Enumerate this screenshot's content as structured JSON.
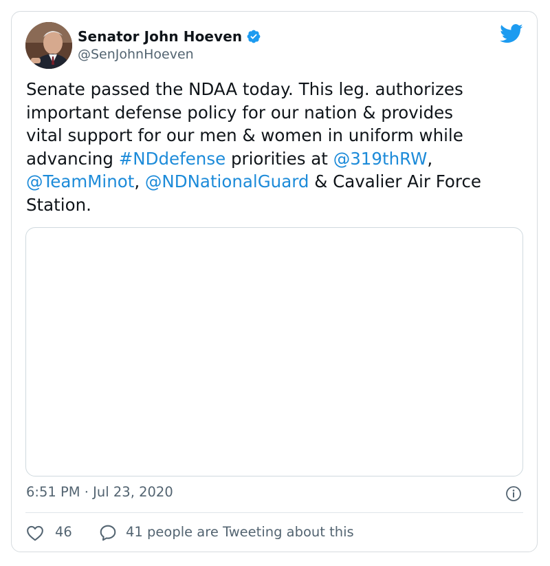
{
  "author": {
    "display_name": "Senator John Hoeven",
    "handle": "@SenJohnHoeven",
    "verified": true,
    "avatar": "portrait-photo"
  },
  "tweet": {
    "text_1": "Senate passed the NDAA today. This leg. authorizes\nimportant defense policy for our nation & provides\nvital support for our men & women in uniform while\nadvancing ",
    "hashtag": "#NDdefense",
    "text_2": " priorities at ",
    "mention_1": "@319thRW",
    "text_3": ",\n",
    "mention_2": "@TeamMinot",
    "text_4": ", ",
    "mention_3": "@NDNationalGuard",
    "text_5": " & Cavalier Air Force\nStation."
  },
  "timestamp": "6:51 PM · Jul 23, 2020",
  "engagement": {
    "like_count": "46",
    "discussion_text": "41 people are Tweeting about this"
  },
  "icons": {
    "brand": "twitter-bird-icon",
    "verified": "verified-badge-icon",
    "info": "info-icon",
    "like": "heart-icon",
    "reply": "speech-bubble-icon"
  },
  "colors": {
    "brand": "#1d9bf0",
    "link": "#1d8bd9",
    "text": "#0f1419",
    "secondary": "#536471",
    "border": "#d6dbdf"
  }
}
